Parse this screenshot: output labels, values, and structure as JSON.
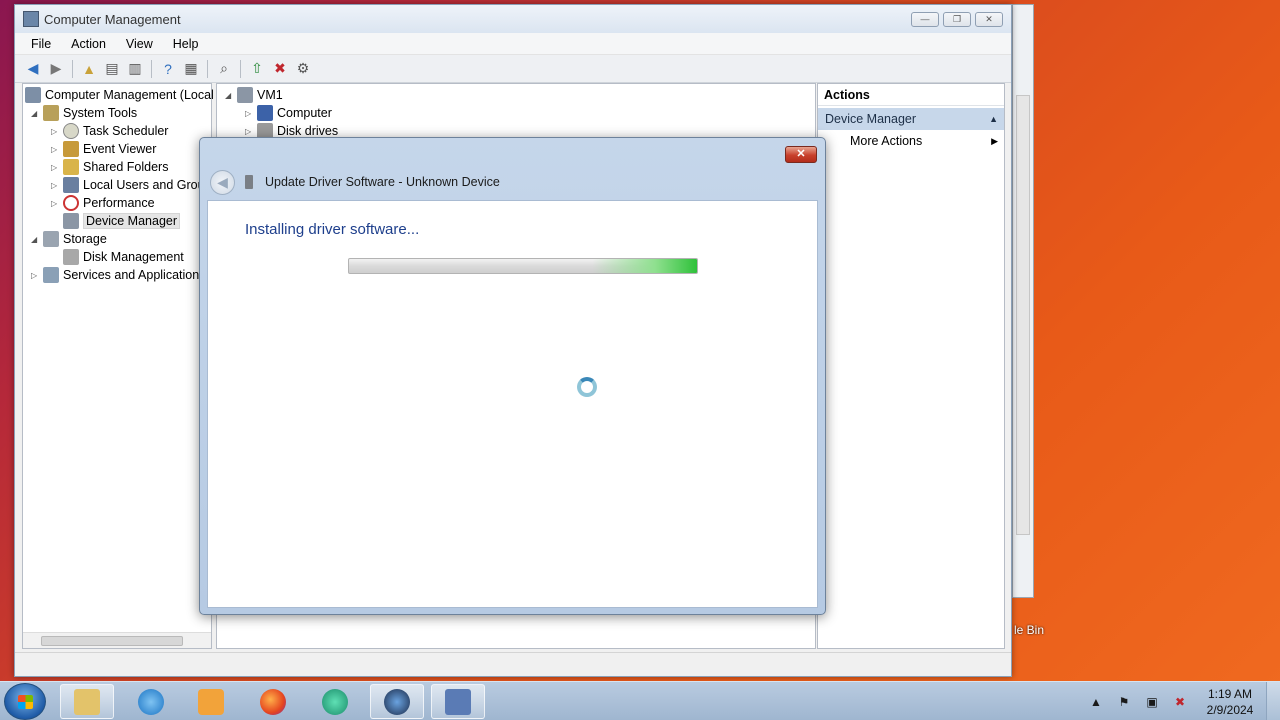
{
  "window": {
    "title": "Computer Management",
    "controls": {
      "minimize": "—",
      "restore": "❐",
      "close": "✕"
    }
  },
  "menu": [
    "File",
    "Action",
    "View",
    "Help"
  ],
  "tree": {
    "root": "Computer Management (Local",
    "system_tools": "System Tools",
    "task_scheduler": "Task Scheduler",
    "event_viewer": "Event Viewer",
    "shared_folders": "Shared Folders",
    "local_users": "Local Users and Group",
    "performance": "Performance",
    "device_manager": "Device Manager",
    "storage": "Storage",
    "disk_management": "Disk Management",
    "services": "Services and Applications"
  },
  "devices": {
    "root": "VM1",
    "computer": "Computer",
    "disk_drives": "Disk drives"
  },
  "actions": {
    "header": "Actions",
    "section": "Device Manager",
    "more": "More Actions"
  },
  "dialog": {
    "close": "✕",
    "title": "Update Driver Software - Unknown Device",
    "heading": "Installing driver software...",
    "progress_state": "indeterminate"
  },
  "desktop": {
    "recycle_label": "le Bin"
  },
  "taskbar": {
    "time": "1:19 AM",
    "date": "2/9/2024"
  },
  "colors": {
    "heading": "#1e3f8c",
    "progress_green": "#2fc13a",
    "close_red": "#c8402c"
  }
}
